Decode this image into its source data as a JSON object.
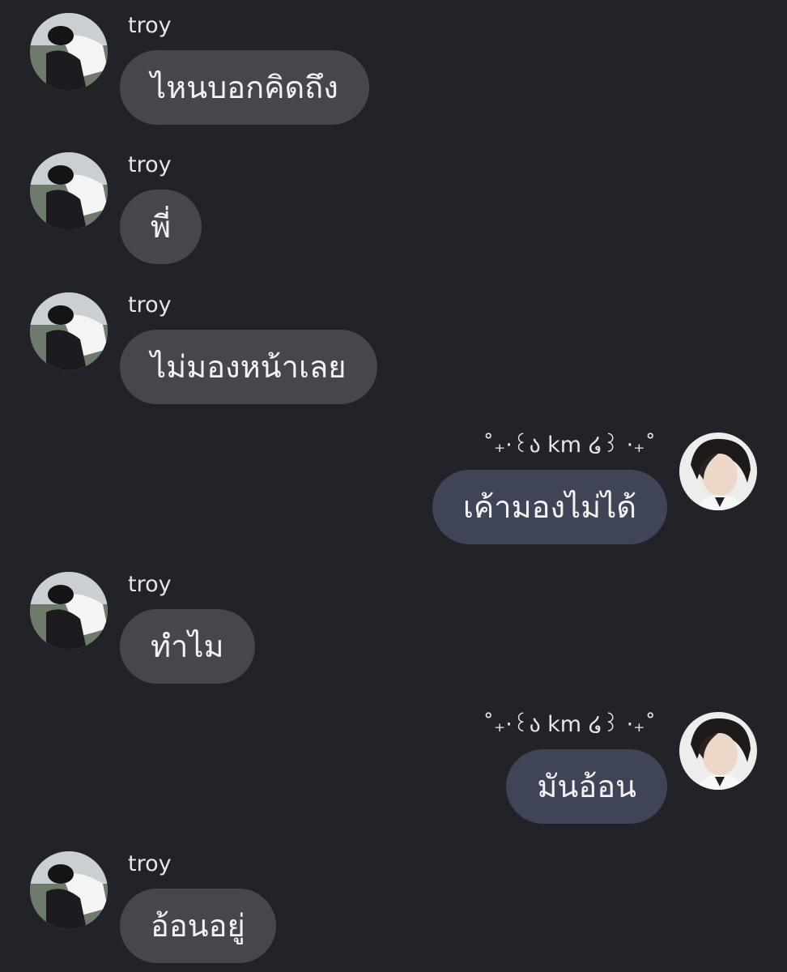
{
  "messages": [
    {
      "side": "incoming",
      "sender": "troy",
      "text": "ไหนบอกคิดถึง",
      "avatar": "troy-avatar"
    },
    {
      "side": "incoming",
      "sender": "troy",
      "text": "พี่",
      "avatar": "troy-avatar"
    },
    {
      "side": "incoming",
      "sender": "troy",
      "text": "ไม่มองหน้าเลย",
      "avatar": "troy-avatar"
    },
    {
      "side": "outgoing",
      "sender": "˚₊·꒰ა km ໒꒱ ·₊˚",
      "text": "เค้ามองไม่ได้",
      "avatar": "self-avatar"
    },
    {
      "side": "incoming",
      "sender": "troy",
      "text": "ทำไม",
      "avatar": "troy-avatar"
    },
    {
      "side": "outgoing",
      "sender": "˚₊·꒰ა km ໒꒱ ·₊˚",
      "text": "มันอ้อน",
      "avatar": "self-avatar"
    },
    {
      "side": "incoming",
      "sender": "troy",
      "text": "อ้อนอยู่",
      "avatar": "troy-avatar"
    }
  ],
  "colors": {
    "background": "#222329",
    "incoming_bubble": "#46464c",
    "outgoing_bubble": "#3f4556",
    "text": "#f2f2f4"
  }
}
